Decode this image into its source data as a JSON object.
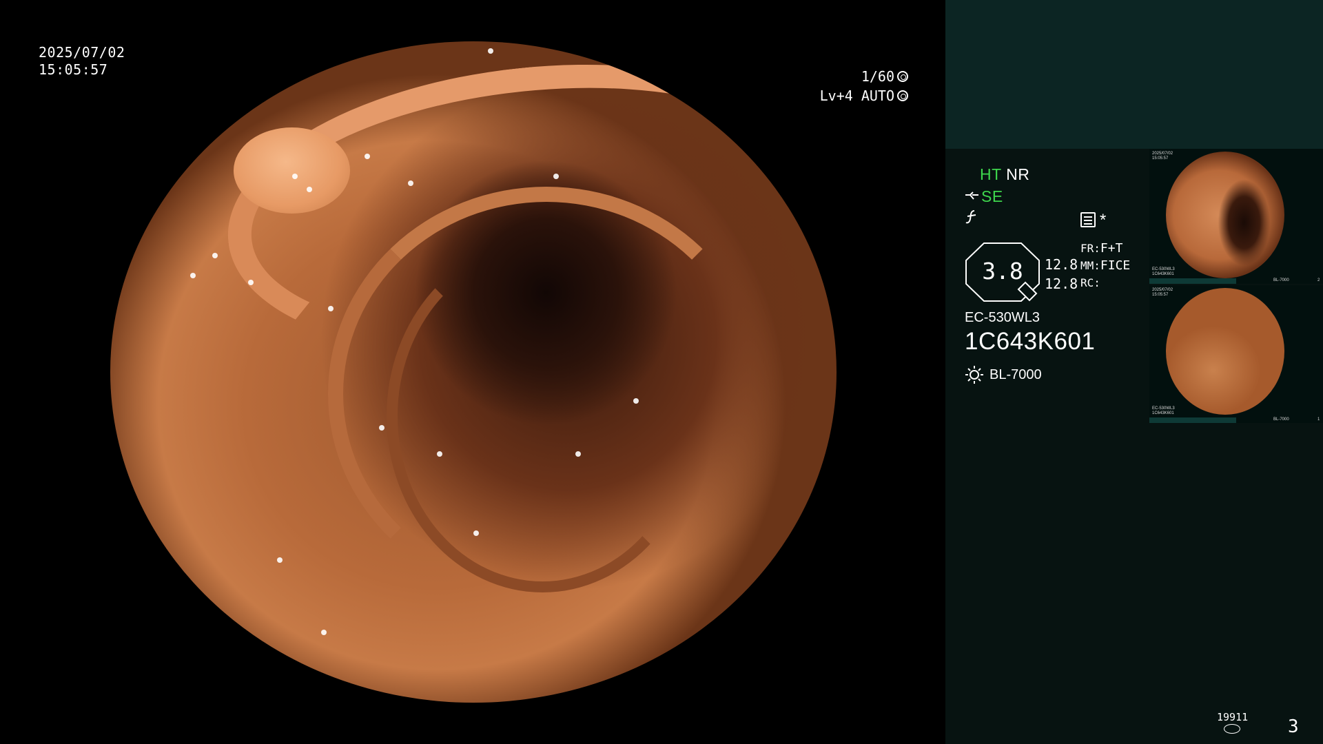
{
  "overlay": {
    "date": "2025/07/02",
    "time": "15:05:57",
    "shutter": "1/60",
    "level": "Lv+4 AUTO"
  },
  "panel": {
    "modes": {
      "ht": "HT",
      "nr": "NR",
      "se": "SE"
    },
    "zoom": "3.8",
    "values": [
      "12.8",
      "12.8"
    ],
    "labels": [
      {
        "key": "FR:",
        "value": "F+T"
      },
      {
        "key": "MM:",
        "value": "FICE"
      },
      {
        "key": "RC:",
        "value": ""
      }
    ],
    "star": "*",
    "scope_model": "EC-530WL3",
    "scope_serial": "1C643K601",
    "light_source": "BL-7000"
  },
  "thumbnails": [
    {
      "date": "2025/07/02",
      "time": "15:05:57",
      "model": "EC-530WL3",
      "serial": "1C643K601",
      "light": "BL-7000",
      "index": "2"
    },
    {
      "date": "2025/07/02",
      "time": "15:05:57",
      "model": "EC-530WL3",
      "serial": "1C643K601",
      "light": "BL-7000",
      "index": "1"
    }
  ],
  "footer": {
    "counter": "19911",
    "page": "3"
  },
  "colors": {
    "panel_bg": "#071311",
    "panel_top": "#0c2523",
    "mode_green": "#3ed64d"
  }
}
